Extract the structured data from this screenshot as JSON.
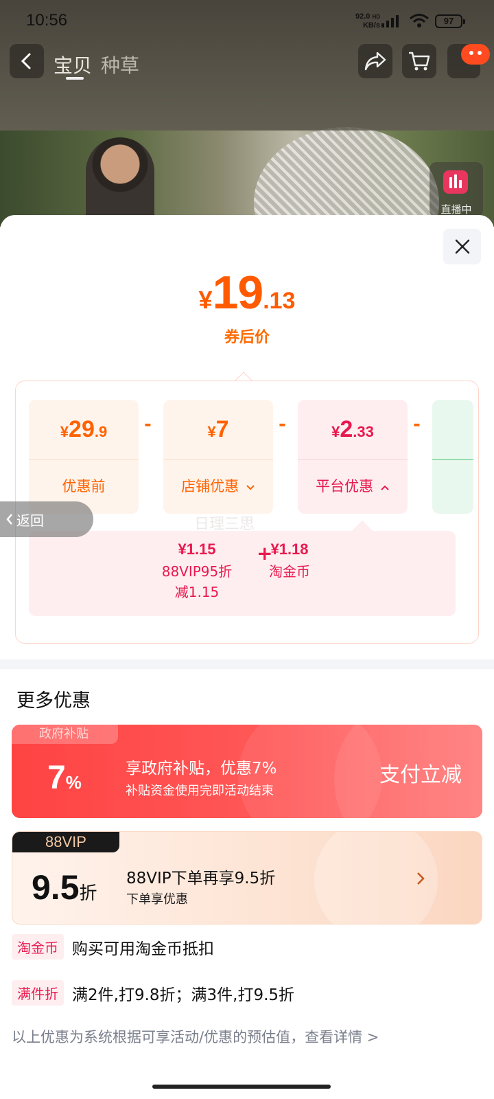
{
  "status_bar": {
    "time": "10:56",
    "net_speed_value": "92.0",
    "net_speed_unit": "KB/s",
    "net_hd": "HD",
    "battery": "97"
  },
  "nav": {
    "tabs": [
      "宝贝",
      "种草"
    ],
    "active_tab": 0
  },
  "live": {
    "label": "直播中"
  },
  "price": {
    "currency": "¥",
    "integer": "19",
    "decimal": ".13",
    "label": "券后价"
  },
  "breakdown": {
    "before": {
      "currency": "¥",
      "integer": "29",
      "decimal": ".9",
      "label": "优惠前"
    },
    "shop": {
      "currency": "¥",
      "integer": "7",
      "decimal": "",
      "label": "店铺优惠"
    },
    "platform": {
      "currency": "¥",
      "integer": "2",
      "decimal": ".33",
      "label": "平台优惠"
    },
    "operator": "-",
    "watermark": "日理三思",
    "platform_details": {
      "plus": "+",
      "items": [
        {
          "amount": "¥1.15",
          "desc_line1": "88VIP95折",
          "desc_line2": "减1.15"
        },
        {
          "amount": "¥1.18",
          "desc_line1": "淘金币",
          "desc_line2": ""
        }
      ]
    }
  },
  "more": {
    "title": "更多优惠",
    "gov": {
      "tag": "政府补贴",
      "pct": "7",
      "pct_unit": "%",
      "main": "享政府补贴，优惠7%",
      "sub": "补贴资金使用完即活动结束",
      "cta": "支付立减"
    },
    "vip": {
      "tag": "88VIP",
      "value": "9.5",
      "unit": "折",
      "main": "88VIP下单再享9.5折",
      "sub": "下单享优惠"
    },
    "rows": [
      {
        "tag": "淘金币",
        "text": "购买可用淘金币抵扣"
      },
      {
        "tag": "满件折",
        "text": "满2件,打9.8折；满3件,打9.5折"
      }
    ],
    "footnote": "以上优惠为系统根据可享活动/优惠的预估值，查看详情 >"
  },
  "back_pill": {
    "label": "返回"
  },
  "colors": {
    "accent_orange": "#ff5a00",
    "accent_red": "#e8194e",
    "gov_red": "#ff4343"
  }
}
